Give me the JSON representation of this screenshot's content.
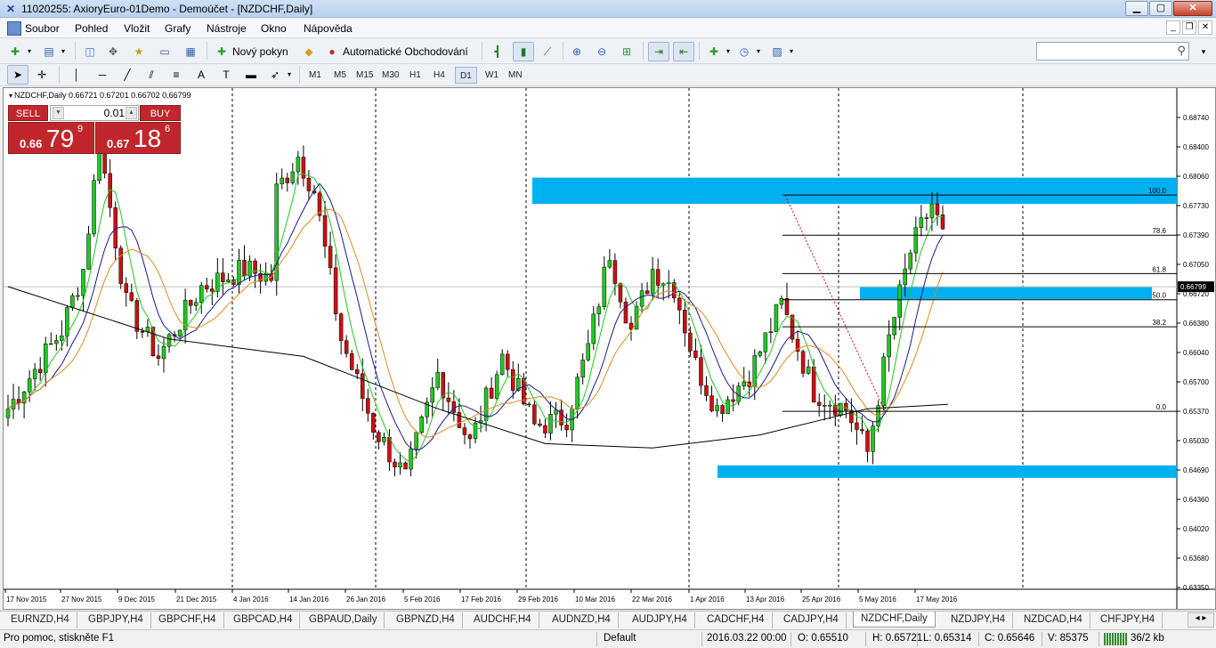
{
  "window": {
    "title": "11020255: AxioryEuro-01Demo - Demoúčet - [NZDCHF,Daily]",
    "app_icon": "x-icon",
    "minimize": "▁",
    "maximize": "▢",
    "close": "✕"
  },
  "menu": {
    "items": [
      "Soubor",
      "Pohled",
      "Vložit",
      "Grafy",
      "Nástroje",
      "Okno",
      "Nápověda"
    ]
  },
  "toolbar": {
    "new_order_label": "Nový pokyn",
    "auto_trading_label": "Automatické Obchodování",
    "search_placeholder": ""
  },
  "timeframes": [
    "M1",
    "M5",
    "M15",
    "M30",
    "H1",
    "H4",
    "D1",
    "W1",
    "MN"
  ],
  "active_timeframe": "D1",
  "chart": {
    "symbol_line": "NZDCHF,Daily  0.66721 0.67201 0.66702 0.66799",
    "trade_panel": {
      "sell_label": "SELL",
      "buy_label": "BUY",
      "lot": "0.01",
      "sell_small": "0.66",
      "sell_big": "79",
      "sell_sup": "9",
      "buy_small": "0.67",
      "buy_big": "18",
      "buy_sup": "6"
    },
    "price_labels": [
      "0.68740",
      "0.68400",
      "0.68060",
      "0.67730",
      "0.67390",
      "0.67050",
      "0.66720",
      "0.66380",
      "0.66040",
      "0.65700",
      "0.65370",
      "0.65030",
      "0.64690",
      "0.64360",
      "0.64020",
      "0.63680",
      "0.63350"
    ],
    "current_price": "0.66799",
    "date_labels": [
      "17 Nov 2015",
      "27 Nov 2015",
      "9 Dec 2015",
      "21 Dec 2015",
      "4 Jan 2016",
      "14 Jan 2016",
      "26 Jan 2016",
      "5 Feb 2016",
      "17 Feb 2016",
      "29 Feb 2016",
      "10 Mar 2016",
      "22 Mar 2016",
      "1 Apr 2016",
      "13 Apr 2016",
      "25 Apr 2016",
      "5 May 2016",
      "17 May 2016"
    ],
    "fibo_levels": [
      {
        "label": "100.0",
        "price": 0.6785
      },
      {
        "label": "78.6",
        "price": 0.6739
      },
      {
        "label": "61.8",
        "price": 0.6695
      },
      {
        "label": "50.0",
        "price": 0.6665
      },
      {
        "label": "38.2",
        "price": 0.6634
      },
      {
        "label": "0.0",
        "price": 0.6537
      }
    ],
    "zones": [
      {
        "from_price": 0.6775,
        "to_price": 0.6805
      },
      {
        "from_price": 0.6667,
        "to_price": 0.668
      },
      {
        "from_price": 0.6462,
        "to_price": 0.6475
      }
    ],
    "colors": {
      "bull": "#22c822",
      "bear": "#cc1111",
      "zone": "#00b0f0",
      "ma_fast": "#22c822",
      "ma_mid": "#1a1a8c",
      "ma_slow": "#e08a1e",
      "ma_long": "#000000"
    }
  },
  "tabs": [
    "EURNZD,H4",
    "GBPJPY,H4",
    "GBPCHF,H4",
    "GBPCAD,H4",
    "GBPAUD,Daily",
    "GBPNZD,H4",
    "AUDCHF,H4",
    "AUDNZD,H4",
    "AUDJPY,H4",
    "CADCHF,H4",
    "CADJPY,H4",
    "NZDCHF,Daily",
    "NZDJPY,H4",
    "NZDCAD,H4",
    "CHFJPY,H4"
  ],
  "active_tab": "NZDCHF,Daily",
  "status": {
    "help": "Pro pomoc, stiskněte F1",
    "profile": "Default",
    "datetime": "2016.03.22 00:00",
    "open": "O: 0.65510",
    "high": "H: 0.65721",
    "low": "L: 0.65314",
    "close": "C: 0.65646",
    "volume": "V: 85375",
    "traffic": "36/2 kb"
  }
}
